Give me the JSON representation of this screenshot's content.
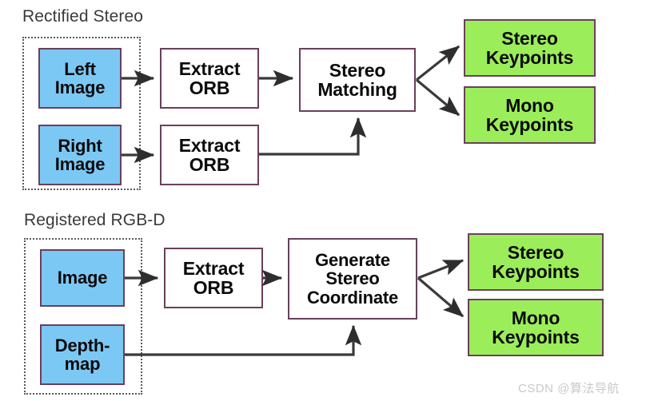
{
  "diagram": {
    "title_top": "Rectified Stereo",
    "title_bottom": "Registered RGB-D",
    "colors": {
      "input_fill": "#7cc8f5",
      "process_fill": "#ffffff",
      "output_fill": "#9bee5a",
      "node_border": "#6b3f5a",
      "group_border": "#5a5a5a",
      "arrow": "#3a3a3a",
      "label_text": "#3a3a3a",
      "watermark_text": "#c9c9c9"
    },
    "sections": [
      {
        "name": "rectified-stereo",
        "label": "Rectified Stereo",
        "inputs": [
          {
            "line1": "Left",
            "line2": "Image"
          },
          {
            "line1": "Right",
            "line2": "Image"
          }
        ],
        "processes": [
          {
            "line1": "Extract",
            "line2": "ORB"
          },
          {
            "line1": "Extract",
            "line2": "ORB"
          }
        ],
        "merge": {
          "line1": "Stereo",
          "line2": "Matching"
        },
        "outputs": [
          {
            "line1": "Stereo",
            "line2": "Keypoints"
          },
          {
            "line1": "Mono",
            "line2": "Keypoints"
          }
        ]
      },
      {
        "name": "registered-rgbd",
        "label": "Registered RGB-D",
        "inputs": [
          {
            "line1": "Image",
            "line2": ""
          },
          {
            "line1": "Depth-",
            "line2": "map"
          }
        ],
        "processes": [
          {
            "line1": "Extract",
            "line2": "ORB"
          }
        ],
        "merge": {
          "line1": "Generate",
          "line2": "Stereo",
          "line3": "Coordinate"
        },
        "outputs": [
          {
            "line1": "Stereo",
            "line2": "Keypoints"
          },
          {
            "line1": "Mono",
            "line2": "Keypoints"
          }
        ]
      }
    ],
    "watermark": "CSDN @算法导航"
  }
}
